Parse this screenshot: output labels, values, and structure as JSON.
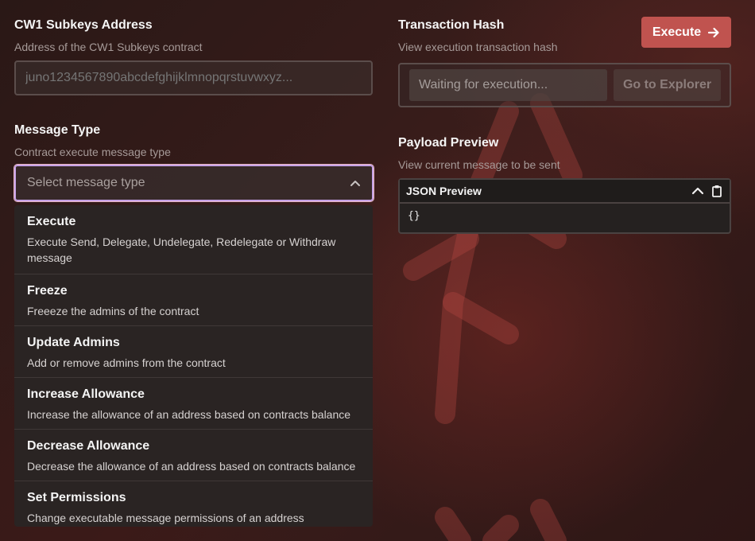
{
  "address": {
    "label": "CW1 Subkeys Address",
    "sublabel": "Address of the CW1 Subkeys contract",
    "placeholder": "juno1234567890abcdefghijklmnopqrstuvwxyz..."
  },
  "message_type": {
    "label": "Message Type",
    "sublabel": "Contract execute message type",
    "placeholder": "Select message type",
    "options": [
      {
        "title": "Execute",
        "description": "Execute Send, Delegate, Undelegate, Redelegate or Withdraw message"
      },
      {
        "title": "Freeze",
        "description": "Freeeze the admins of the contract"
      },
      {
        "title": "Update Admins",
        "description": "Add or remove admins from the contract"
      },
      {
        "title": "Increase Allowance",
        "description": "Increase the allowance of an address based on contracts balance"
      },
      {
        "title": "Decrease Allowance",
        "description": "Decrease the allowance of an address based on contracts balance"
      },
      {
        "title": "Set Permissions",
        "description": "Change executable message permissions of an address"
      }
    ]
  },
  "transaction": {
    "label": "Transaction Hash",
    "sublabel": "View execution transaction hash",
    "waiting_text": "Waiting for execution...",
    "explorer_label": "Go to Explorer"
  },
  "execute_button": {
    "label": "Execute",
    "icon": "arrow-right-icon"
  },
  "payload": {
    "label": "Payload Preview",
    "sublabel": "View current message to be sent",
    "panel_title": "JSON Preview",
    "content": "{}"
  },
  "colors": {
    "accent": "#c0534f",
    "focus_ring": "#c7a3e8"
  }
}
